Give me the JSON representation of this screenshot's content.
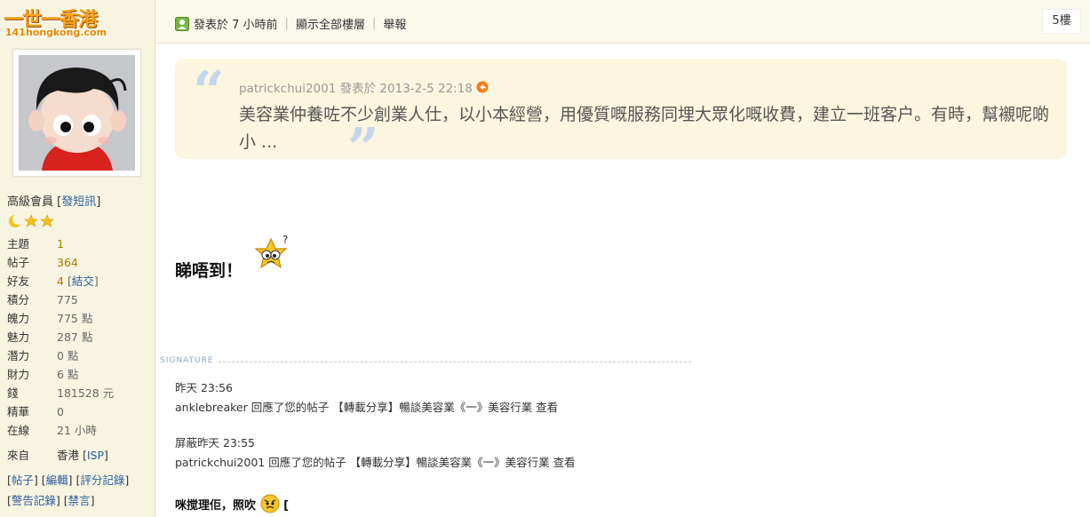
{
  "logo": {
    "line1": "一世一香港",
    "line2": "141hongkong.com"
  },
  "user": {
    "rank": "高級會員",
    "pm_link": "發短訊",
    "stats": [
      {
        "label": "主題",
        "value": "1"
      },
      {
        "label": "帖子",
        "value": "364"
      },
      {
        "label": "好友",
        "value": "4",
        "extra": "結交"
      },
      {
        "label": "積分",
        "value": "775"
      },
      {
        "label": "魄力",
        "value": "775 點"
      },
      {
        "label": "魅力",
        "value": "287 點"
      },
      {
        "label": "潛力",
        "value": "0 點"
      },
      {
        "label": "財力",
        "value": "6 點"
      },
      {
        "label": "錢",
        "value": "181528 元"
      },
      {
        "label": "精華",
        "value": "0"
      },
      {
        "label": "在線",
        "value": "21 小時"
      }
    ],
    "from_label": "來自",
    "from_value": "香港",
    "from_extra": "ISP",
    "links1": [
      "帖子",
      "編輯",
      "評分記錄"
    ],
    "links2": [
      "警告記錄",
      "禁言"
    ]
  },
  "topbar": {
    "posted": "發表於 7 小時前",
    "show_all": "顯示全部樓層",
    "report": "舉報",
    "floor": "5樓"
  },
  "quote": {
    "author": "patrickchui2001",
    "posted_label": "發表於",
    "date": "2013-2-5 22:18",
    "body": "美容業仲養咗不少創業人仕，以小本經營，用優質嘅服務同埋大眾化嘅收費，建立一班客户。有時，幫襯呢啲小 ..."
  },
  "post": {
    "text": "睇唔到！"
  },
  "signature": {
    "label": "SIGNATURE",
    "entries": [
      {
        "time": "昨天 23:56",
        "text": "anklebreaker 回應了您的帖子 【轉載分享】暢談美容業《一》美容行業   查看"
      },
      {
        "time": "屏蔽昨天 23:55",
        "text": "patrickchui2001 回應了您的帖子 【轉載分享】暢談美容業《一》美容行業   查看"
      }
    ],
    "bottom": "咪搅理佢，照吹"
  }
}
